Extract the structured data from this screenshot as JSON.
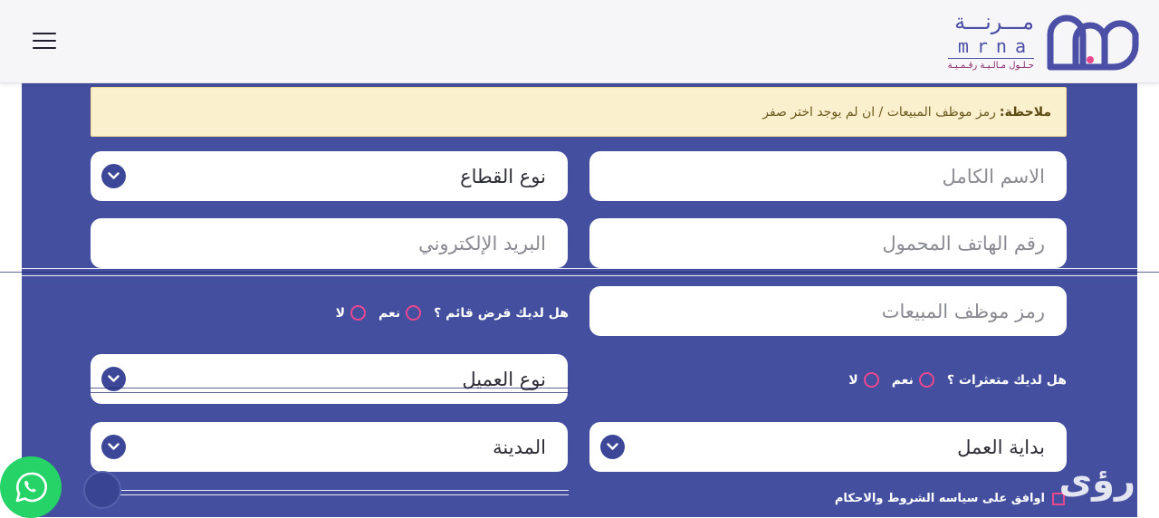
{
  "brand": {
    "name_ar": "مـــرنـــة",
    "name_latin": "mrna",
    "tagline": "حـلـول مـالـيـة رقـمـيـة"
  },
  "note": {
    "label": "ملاحظة:",
    "text": "رمز موظف المبيعات / ان لم يوجد اختر صفر"
  },
  "form": {
    "full_name_placeholder": "الاسم الكامل",
    "sector_type": "نوع القطاع",
    "mobile_placeholder": "رقم الهاتف المحمول",
    "email_placeholder": "البريد الإلكتروني",
    "sales_code_placeholder": "رمز موظف المبيعات",
    "existing_loan_question": "هل لديك قرض قائم ؟",
    "defaults_question": "هل لديك متعثرات ؟",
    "yes": "نعم",
    "no": "لا",
    "client_type": "نوع العميل",
    "work_start": "بداية العمل",
    "city": "المدينة",
    "terms_label": "اوافق على سياسه الشروط والاحكام"
  },
  "watermark": "رؤى",
  "colors": {
    "panel": "#44509f",
    "accent_pink": "#e9488f",
    "note_bg": "#fbf0cd",
    "whatsapp": "#25d366"
  },
  "icons": [
    "hamburger-menu-icon",
    "chevron-down-icon",
    "whatsapp-icon",
    "radio-icon",
    "checkbox-icon"
  ]
}
